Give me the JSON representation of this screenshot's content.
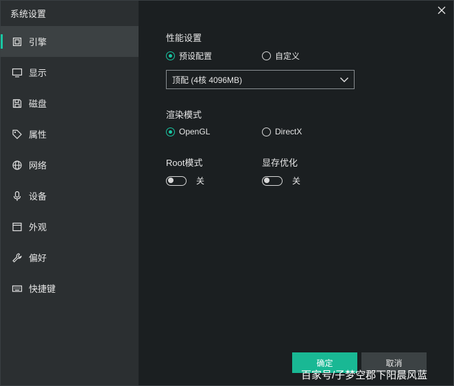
{
  "window": {
    "title": "系统设置"
  },
  "sidebar": {
    "items": [
      {
        "label": "引擎",
        "icon": "chip-icon",
        "active": true
      },
      {
        "label": "显示",
        "icon": "monitor-icon",
        "active": false
      },
      {
        "label": "磁盘",
        "icon": "disk-icon",
        "active": false
      },
      {
        "label": "属性",
        "icon": "tag-icon",
        "active": false
      },
      {
        "label": "网络",
        "icon": "globe-icon",
        "active": false
      },
      {
        "label": "设备",
        "icon": "microphone-icon",
        "active": false
      },
      {
        "label": "外观",
        "icon": "window-icon",
        "active": false
      },
      {
        "label": "偏好",
        "icon": "wrench-icon",
        "active": false
      },
      {
        "label": "快捷键",
        "icon": "keyboard-icon",
        "active": false
      }
    ]
  },
  "performance": {
    "title": "性能设置",
    "preset_label": "预设配置",
    "custom_label": "自定义",
    "selected": "预设配置",
    "select_value": "顶配 (4核 4096MB)"
  },
  "render": {
    "title": "渲染模式",
    "opengl_label": "OpenGL",
    "directx_label": "DirectX",
    "selected": "OpenGL"
  },
  "root": {
    "title": "Root模式",
    "state_label": "关",
    "on": false
  },
  "vram": {
    "title": "显存优化",
    "state_label": "关",
    "on": false
  },
  "buttons": {
    "ok": "确定",
    "cancel": "取消"
  },
  "watermark": "百家号/子梦空郡下阳晨风蓝",
  "colors": {
    "accent": "#19c8a4",
    "sidebar_bg": "#2b2f31",
    "content_bg": "#1b1f21",
    "active_item_bg": "#3c4143"
  }
}
